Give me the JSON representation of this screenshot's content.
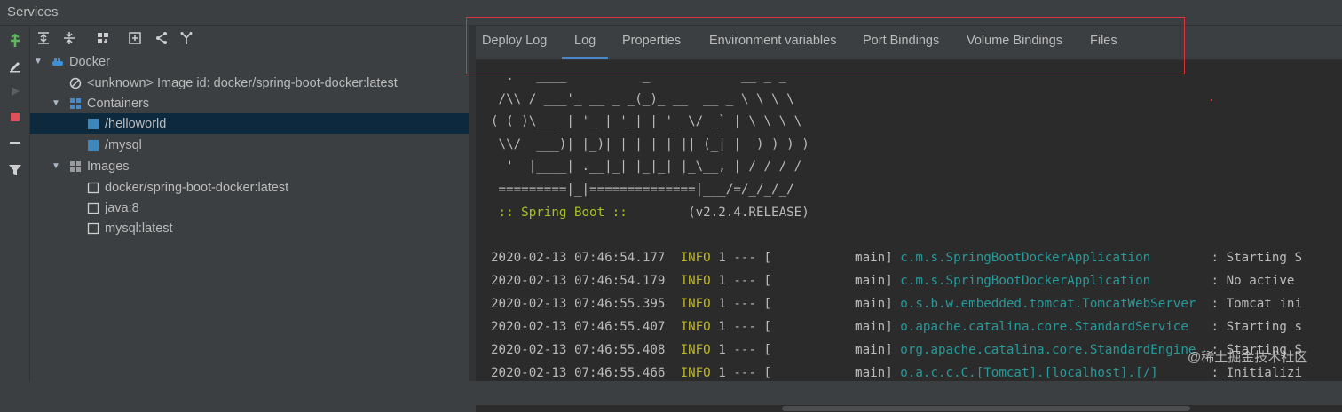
{
  "window": {
    "title": "Services"
  },
  "tabs": [
    {
      "label": "Deploy Log",
      "active": false
    },
    {
      "label": "Log",
      "active": true
    },
    {
      "label": "Properties",
      "active": false
    },
    {
      "label": "Environment variables",
      "active": false
    },
    {
      "label": "Port Bindings",
      "active": false
    },
    {
      "label": "Volume Bindings",
      "active": false
    },
    {
      "label": "Files",
      "active": false
    }
  ],
  "tree": {
    "docker": "Docker",
    "unknown_image": "<unknown> Image id: docker/spring-boot-docker:latest",
    "containers": "Containers",
    "container_items": [
      "/helloworld",
      "/mysql"
    ],
    "images": "Images",
    "image_items": [
      "docker/spring-boot-docker:latest",
      "java:8",
      "mysql:latest"
    ]
  },
  "console": {
    "banner": [
      "  .   ____          _            __ _ _",
      " /\\\\ / ___'_ __ _ _(_)_ __  __ _ \\ \\ \\ \\",
      "( ( )\\___ | '_ | '_| | '_ \\/ _` | \\ \\ \\ \\",
      " \\\\/  ___)| |_)| | | | | || (_| |  ) ) ) )",
      "  '  |____| .__|_| |_|_| |_\\__, | / / / /",
      " =========|_|==============|___/=/_/_/_/"
    ],
    "spring_label": " :: Spring Boot ::        ",
    "spring_version": "(v2.2.4.RELEASE)",
    "lines": [
      {
        "ts": "2020-02-13 07:46:54.177",
        "level": "INFO",
        "mid": " 1 --- [           main] ",
        "logger": "c.m.s.SpringBootDockerApplication       ",
        "msg": " : Starting S"
      },
      {
        "ts": "2020-02-13 07:46:54.179",
        "level": "INFO",
        "mid": " 1 --- [           main] ",
        "logger": "c.m.s.SpringBootDockerApplication       ",
        "msg": " : No active"
      },
      {
        "ts": "2020-02-13 07:46:55.395",
        "level": "INFO",
        "mid": " 1 --- [           main] ",
        "logger": "o.s.b.w.embedded.tomcat.TomcatWebServer ",
        "msg": " : Tomcat ini"
      },
      {
        "ts": "2020-02-13 07:46:55.407",
        "level": "INFO",
        "mid": " 1 --- [           main] ",
        "logger": "o.apache.catalina.core.StandardService  ",
        "msg": " : Starting s"
      },
      {
        "ts": "2020-02-13 07:46:55.408",
        "level": "INFO",
        "mid": " 1 --- [           main] ",
        "logger": "org.apache.catalina.core.StandardEngine ",
        "msg": " : Starting S"
      },
      {
        "ts": "2020-02-13 07:46:55.466",
        "level": "INFO",
        "mid": " 1 --- [           main] ",
        "logger": "o.a.c.c.C.[Tomcat].[localhost].[/]      ",
        "msg": " : Initializi"
      }
    ]
  },
  "watermark": "@稀土掘金技术社区",
  "colors": {
    "accent": "#4a88c7",
    "highlight": "#e0323c",
    "info": "#bbb529",
    "logger": "#299999"
  }
}
